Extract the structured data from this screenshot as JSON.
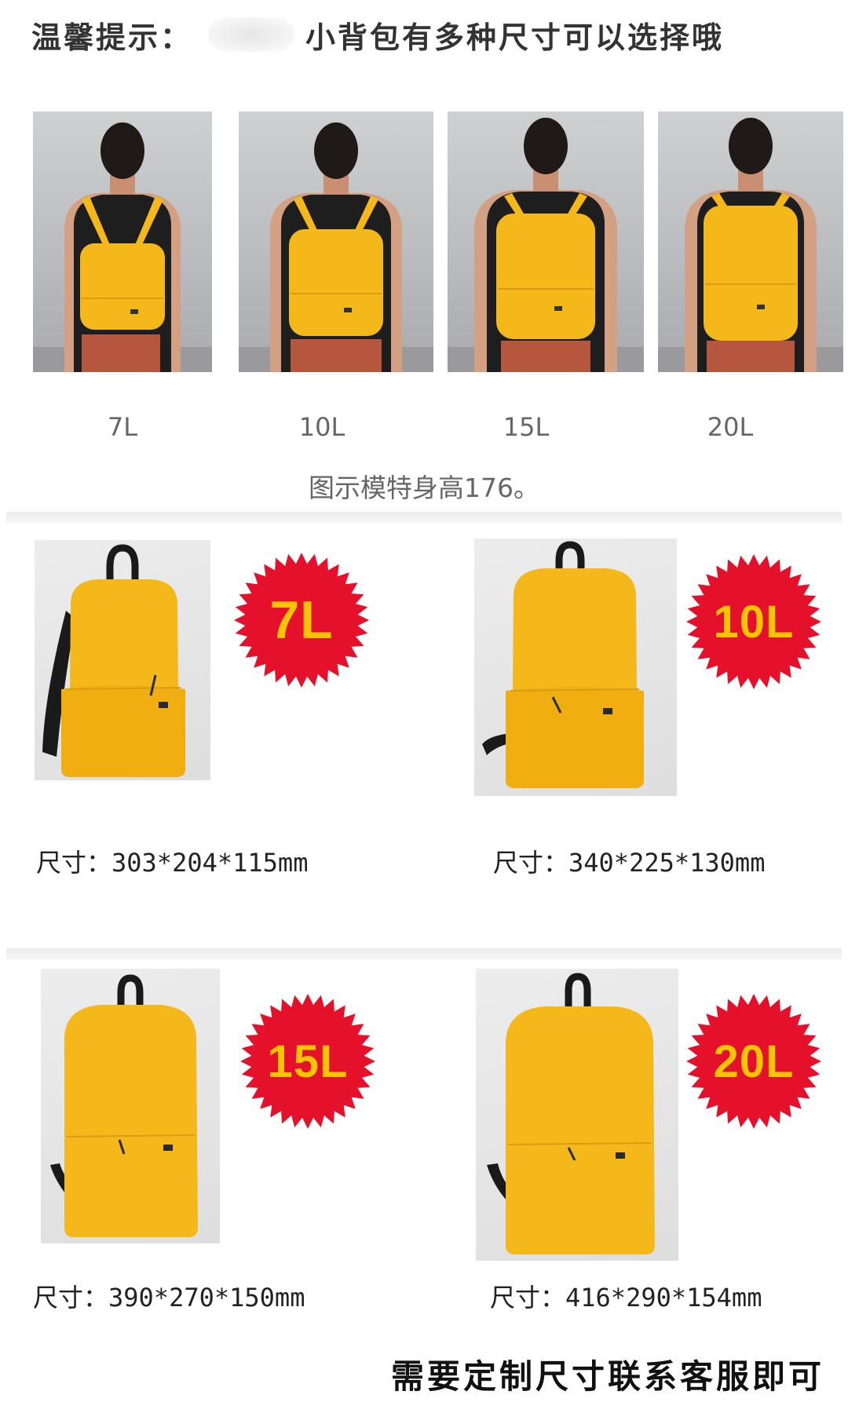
{
  "notice": {
    "prefix": "温馨提示：",
    "message": "小背包有多种尺寸可以选择哦"
  },
  "models": [
    {
      "label": "7L"
    },
    {
      "label": "10L"
    },
    {
      "label": "15L"
    },
    {
      "label": "20L"
    }
  ],
  "caption": "图示模特身高176。",
  "products": [
    {
      "badge": "7L",
      "size": "尺寸：303*204*115mm"
    },
    {
      "badge": "10L",
      "size": "尺寸：340*225*130mm"
    },
    {
      "badge": "15L",
      "size": "尺寸：390*270*150mm"
    },
    {
      "badge": "20L",
      "size": "尺寸：416*290*154mm"
    }
  ],
  "footer": "需要定制尺寸联系客服即可",
  "colors": {
    "backpack": "#f4b81a",
    "badge_red": "#e5102a",
    "badge_text": "#f7c400"
  }
}
